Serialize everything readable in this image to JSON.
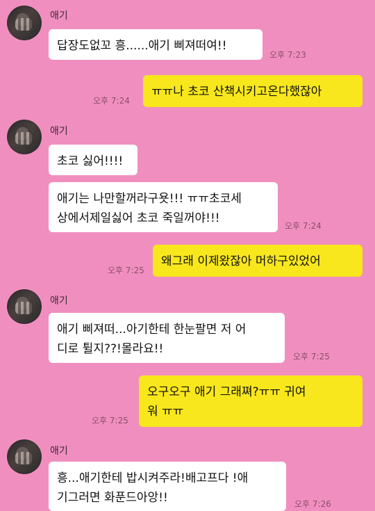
{
  "messages": [
    {
      "sender": "애기",
      "text": "답장도없꼬 흥......애기 삐져떠여!!",
      "time": "오후 7:23"
    },
    {
      "sender": "me",
      "text": "ㅠㅠ나 초코 산책시키고온다했잖아",
      "time": "오후 7:24"
    },
    {
      "sender": "애기",
      "text": "초코 싫어!!!!",
      "time": ""
    },
    {
      "sender": "애기",
      "text": "애기는 나만할꺼라구욧!!! ㅠㅠ초코세\n상에서제일싫어 초코 죽일꺼야!!!",
      "time": "오후 7:24"
    },
    {
      "sender": "me",
      "text": "왜그래 이제왔잖아 머하구있었어",
      "time": "오후 7:25"
    },
    {
      "sender": "애기",
      "text": "애기 삐져떠...아기한테 한눈팔면 저 어\n디로 튈지??!몰라요!!",
      "time": "오후 7:25"
    },
    {
      "sender": "me",
      "text": "오구오구 애기 그래쪄?ㅠㅠ 귀여\n워 ㅠㅠ",
      "time": "오후 7:25"
    },
    {
      "sender": "애기",
      "text": "흥...애기한테 밥시켜주라!배고프다 !애\n기그러면 화푼드아앙!!",
      "time": "오후 7:26"
    }
  ]
}
